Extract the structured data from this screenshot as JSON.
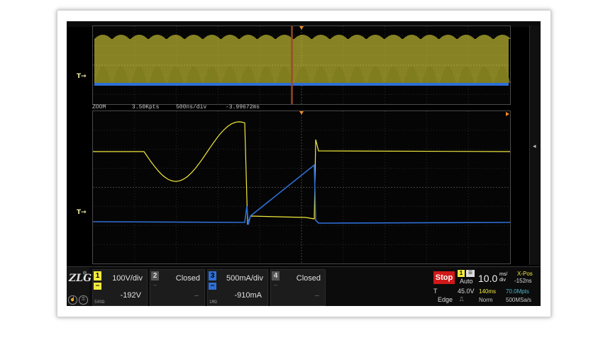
{
  "overview": {
    "trigger_label": "T"
  },
  "zoom_info": {
    "mode": "ZOOM",
    "points": "3.50Kpts",
    "timebase": "500ns/div",
    "offset": "-3.99672ms"
  },
  "zoom_view": {
    "trigger_label": "T"
  },
  "logo": {
    "text": "ZLG",
    "registered": "®"
  },
  "channels": [
    {
      "number": "1",
      "scale": "100V/div",
      "offset": "-192V",
      "coupling": "DC",
      "impedance": "500Ω",
      "color": "#f2ea3c",
      "state": "on"
    },
    {
      "number": "2",
      "scale": "Closed",
      "offset": "--",
      "coupling": "--",
      "color": "#cccccc",
      "state": "off"
    },
    {
      "number": "3",
      "scale": "500mA/div",
      "offset": "-910mA",
      "coupling": "DC",
      "impedance": "1MΩ",
      "color": "#2e6fd6",
      "state": "on"
    },
    {
      "number": "4",
      "scale": "Closed",
      "offset": "--",
      "coupling": "--",
      "color": "#cccccc",
      "state": "off"
    }
  ],
  "acquisition": {
    "run_state": "Stop",
    "trigger_channel": "1",
    "trigger_mode": "Auto",
    "trigger_type": "T",
    "trigger_level": "45.0V",
    "trigger_source": "Edge",
    "timebase_value": "10.0",
    "timebase_unit_top": "ms/",
    "timebase_unit_bottom": "div",
    "xpos_label": "X-Pos",
    "xpos_value": "-152ns",
    "capture_time": "140ms",
    "memory_depth": "70.0Mpts",
    "acq_mode": "Norm",
    "sample_rate": "500MSa/s"
  },
  "colors": {
    "ch1": "#f2ea3c",
    "ch3": "#2e6fd6",
    "trigger": "#f08a1e",
    "stop": "#d01818"
  }
}
